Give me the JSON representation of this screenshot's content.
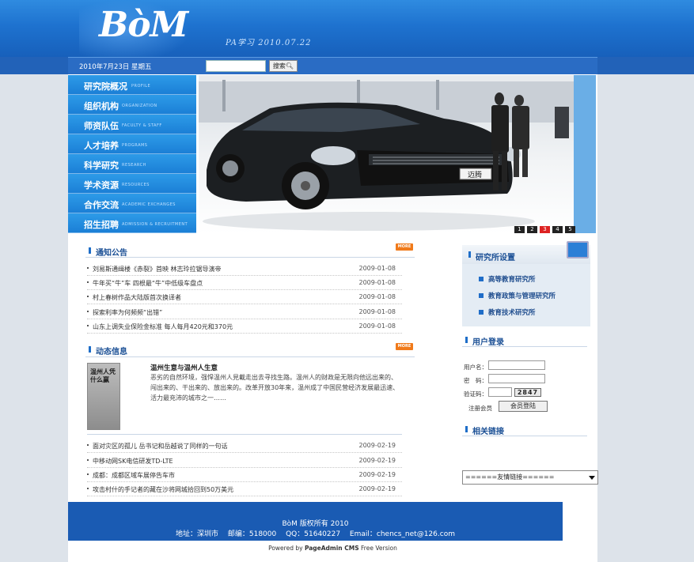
{
  "header": {
    "logo_text": "BòM",
    "tagline": "PA学习 2010.07.22"
  },
  "toolbar": {
    "date": "2010年7月23日 星期五",
    "search_placeholder": "",
    "search_button": "搜索"
  },
  "nav": [
    {
      "cn": "研究院概况",
      "en": "PROFILE"
    },
    {
      "cn": "组织机构",
      "en": "ORGANIZATION"
    },
    {
      "cn": "师资队伍",
      "en": "FACULTY & STAFF"
    },
    {
      "cn": "人才培养",
      "en": "PROGRAMS"
    },
    {
      "cn": "科学研究",
      "en": "RESEARCH"
    },
    {
      "cn": "学术资源",
      "en": "RESOURCES"
    },
    {
      "cn": "合作交流",
      "en": "ACADEMIC EXCHANGES"
    },
    {
      "cn": "招生招聘",
      "en": "ADMISSION & RECRUITMENT"
    }
  ],
  "banner": {
    "plate_text": "迈腾",
    "slides": [
      "1",
      "2",
      "3",
      "4",
      "5"
    ],
    "active_slide": "3"
  },
  "notices": {
    "title": "通知公告",
    "more": "MORE",
    "items": [
      {
        "text": "刘易斯通缉楼《赤裂》首映 林志玲拉锯导演帝",
        "date": "2009-01-08"
      },
      {
        "text": "牛年买“牛”车 四根最“牛”中低级车盘点",
        "date": "2009-01-08"
      },
      {
        "text": "村上春树作品大陆版首次换译者",
        "date": "2009-01-08"
      },
      {
        "text": "探索利率为何频频“出错”",
        "date": "2009-01-08"
      },
      {
        "text": "山东上调失业保险金标准 每人每月420元和370元",
        "date": "2009-01-08"
      }
    ]
  },
  "dynamics": {
    "title": "动态信息",
    "more": "MORE",
    "feature": {
      "image_title": "温州人凭什么赢",
      "headline": "温州生意与温州人生意",
      "body": "恶劣的自然环境，强悍温州人見載走出去寻找生路。温州人的财政是无限向他远出来的、闯出来的、干出来的、放出来的。改革开放30年来，温州成了中国民营经济发展最迅速、活力最充沛的城市之一……"
    },
    "items": [
      {
        "text": "面对灾区的孤儿 岳书记和岳越说了同样的一句话",
        "date": "2009-02-19"
      },
      {
        "text": "中移动网SK电信研发TD-LTE",
        "date": "2009-02-19"
      },
      {
        "text": "成都：成都区域车展停告车市",
        "date": "2009-02-19"
      },
      {
        "text": "攻击村什的手记者的藏在沙将网城拾回到50万美元",
        "date": "2009-02-19"
      }
    ]
  },
  "institutes": {
    "title": "研究所设置",
    "items": [
      "高等教育研究所",
      "教育政策与管理研究所",
      "教育技术研究所"
    ]
  },
  "login": {
    "title": "用户登录",
    "username_label": "用户名：",
    "password_label": "密　码：",
    "captcha_label": "验证码：",
    "captcha_code": "2847",
    "register_label": "注册会员",
    "login_button": "会员登陆"
  },
  "links": {
    "title": "相关链接",
    "select_value": "======友情链接======"
  },
  "footer": {
    "line1": "BòM 版权所有 2010",
    "line2": "地址：深圳市　 邮编：518000　 QQ：51640227　 Email：chencs_net@126.com",
    "powered_prefix": "Powered by ",
    "powered_brand": "PageAdmin CMS",
    "powered_suffix": " Free Version"
  },
  "colors": {
    "header_blue": "#1e72cf",
    "nav_blue": "#1b7fd6",
    "footer_blue": "#1a5bb3",
    "more_orange": "#f07a1a",
    "active_slide": "#dd2222"
  }
}
